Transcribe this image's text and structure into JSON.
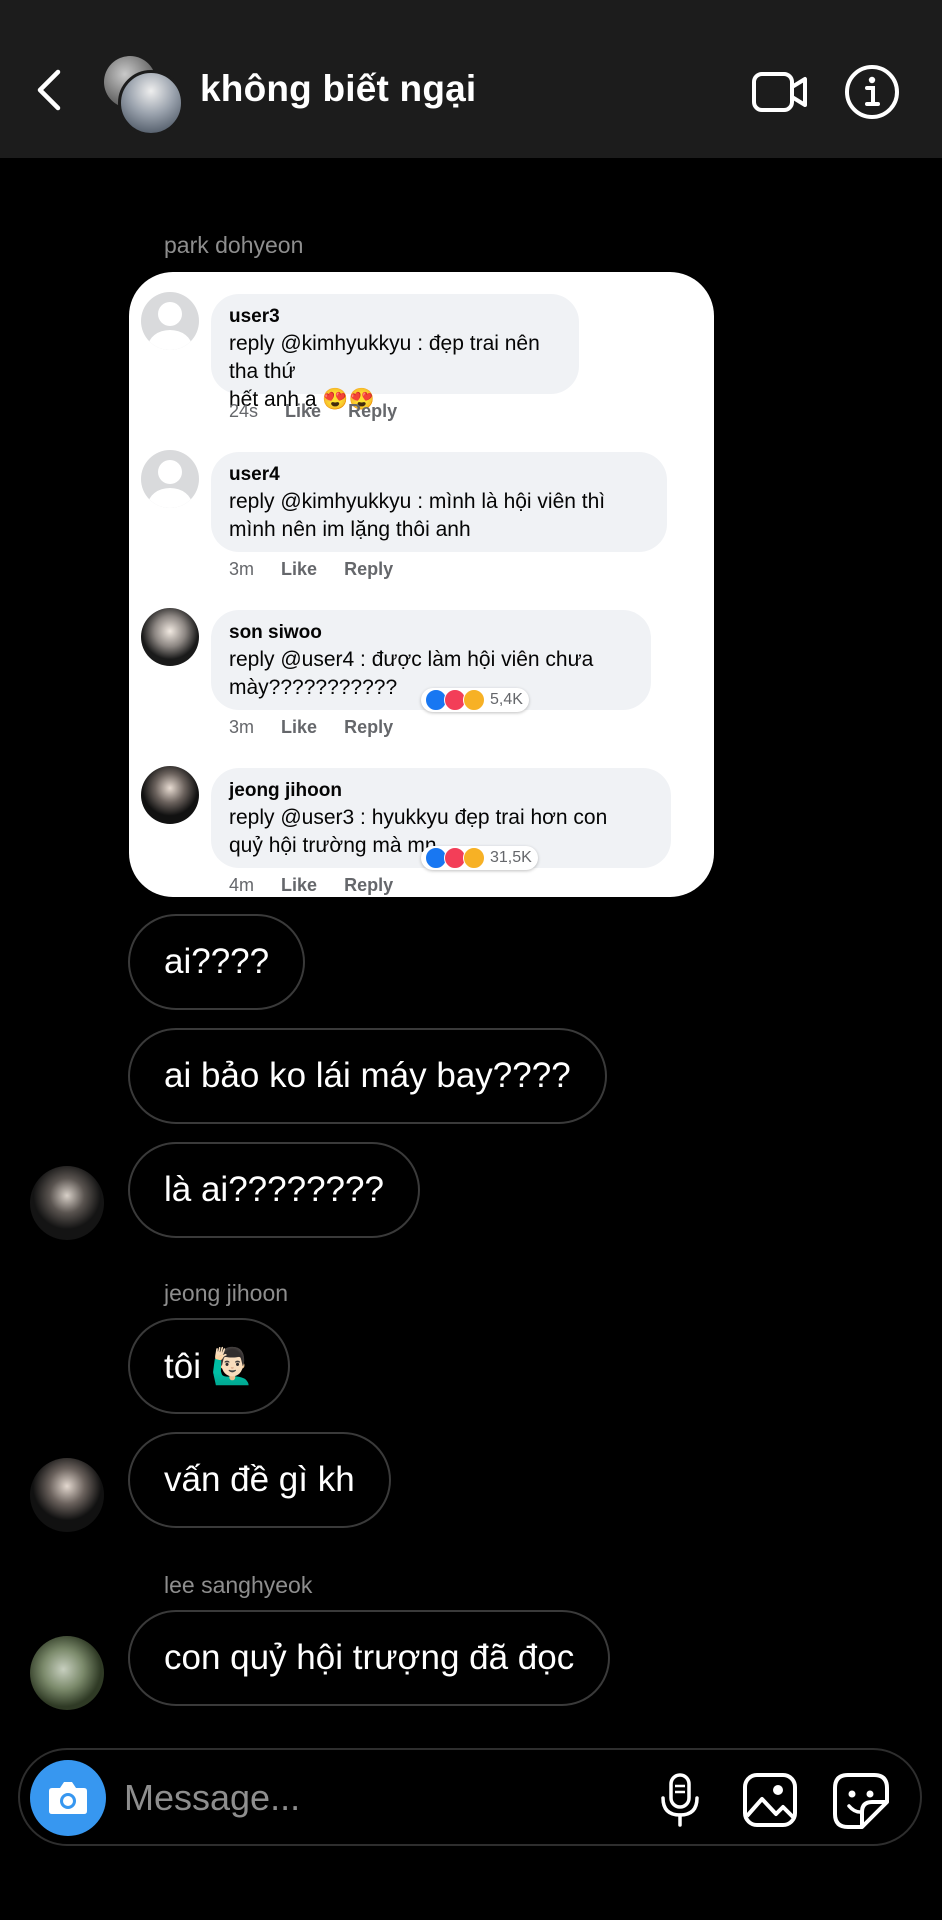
{
  "header": {
    "title": "không biết ngại",
    "back_icon": "chevron-left-icon",
    "video_icon": "video-camera-icon",
    "info_icon": "info-icon"
  },
  "messages": {
    "sender1": "park dohyeon",
    "screenshot": {
      "comments": [
        {
          "name": "user3",
          "line1": "reply @kimhyukkyu : đẹp trai nên tha thứ",
          "line2": "hết anh ạ 😍😍",
          "time": "24s",
          "like": "Like",
          "reply": "Reply"
        },
        {
          "name": "user4",
          "line1": "reply @kimhyukkyu : mình là hội viên thì",
          "line2": "mình nên im lặng thôi anh",
          "time": "3m",
          "like": "Like",
          "reply": "Reply"
        },
        {
          "name": "son siwoo",
          "line1": "reply @user4 : được làm hội viên chưa",
          "line2": "mày???????????",
          "time": "3m",
          "like": "Like",
          "reply": "Reply",
          "reactions": "5,4K"
        },
        {
          "name": "jeong jihoon",
          "line1": "reply @user3 : hyukkyu đẹp trai hơn con",
          "line2": "quỷ hội trường mà mn",
          "time": "4m",
          "like": "Like",
          "reply": "Reply",
          "reactions": "31,5K"
        }
      ]
    },
    "m1": "ai????",
    "m2": "ai bảo ko lái máy bay????",
    "m3": "là ai????????",
    "sender2": "jeong jihoon",
    "m4": "tôi 🙋🏻‍♂️",
    "m5": "vấn đề gì kh",
    "sender3": "lee sanghyeok",
    "m6": "con quỷ hội trượng đã đọc"
  },
  "composer": {
    "placeholder": "Message...",
    "camera_icon": "camera-icon",
    "mic_icon": "microphone-icon",
    "gallery_icon": "image-icon",
    "sticker_icon": "sticker-icon"
  },
  "colors": {
    "background": "#000000",
    "header_bg": "#1c1c1c",
    "camera_button": "#3797f0",
    "bubble_border": "#3a3a3a",
    "sender_gray": "#8e8e8e"
  }
}
